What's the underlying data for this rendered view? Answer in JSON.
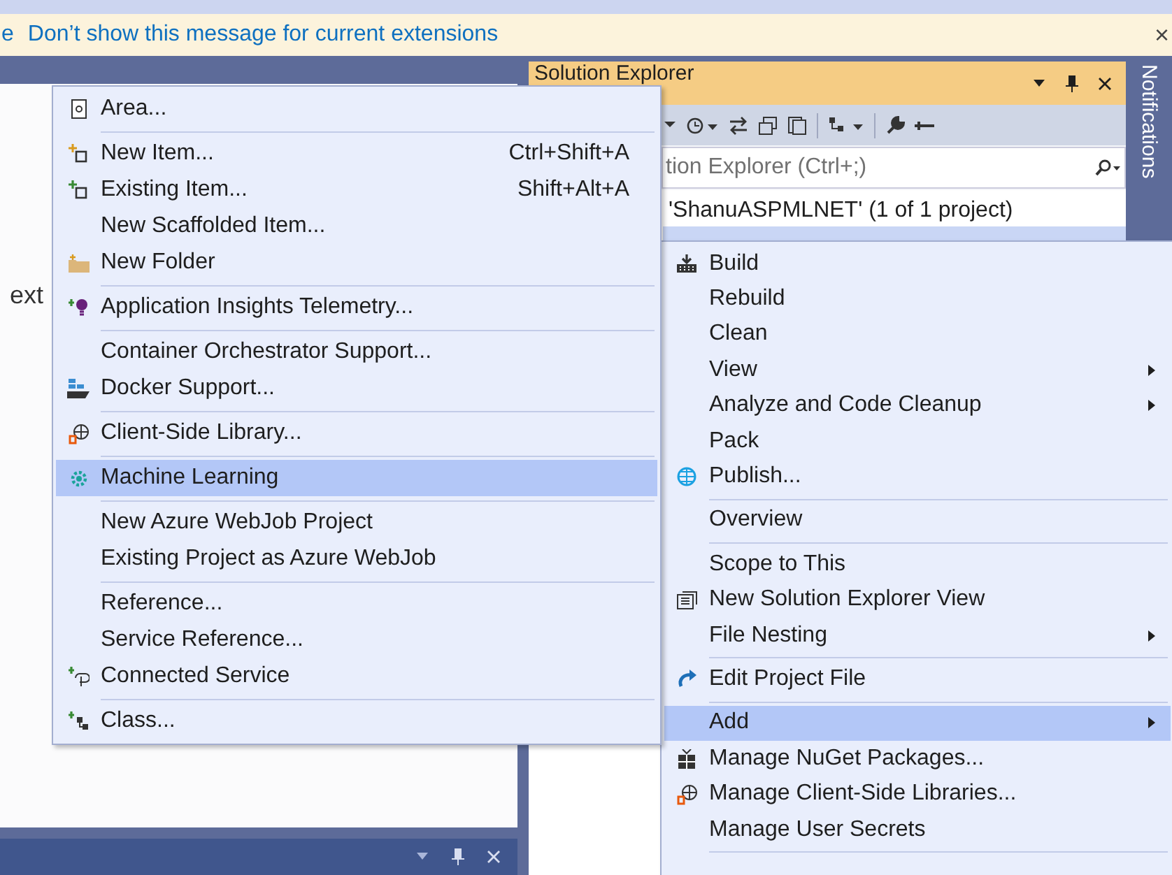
{
  "infobar": {
    "cut_text": "e",
    "link": "Don’t show this message for current extensions",
    "close": "×"
  },
  "editor": {
    "cut_text": "ext"
  },
  "solution_explorer": {
    "title": "Solution Explorer",
    "search": {
      "placeholder": "tion Explorer (Ctrl+;)"
    },
    "tree": [
      {
        "label": "'ShanuASPMLNET' (1 of 1 project)",
        "selected": false
      }
    ]
  },
  "notifications_tab": "Notifications",
  "add_submenu": {
    "groups": [
      [
        {
          "label": "Area...",
          "submenu": false,
          "selected": false
        }
      ],
      [
        {
          "label": "New Item...",
          "shortcut": "Ctrl+Shift+A",
          "submenu": false,
          "selected": false
        },
        {
          "label": "Existing Item...",
          "shortcut": "Shift+Alt+A",
          "submenu": false,
          "selected": false
        },
        {
          "label": "New Scaffolded Item...",
          "submenu": false,
          "selected": false
        },
        {
          "label": "New Folder",
          "submenu": false,
          "selected": false
        }
      ],
      [
        {
          "label": "Application Insights Telemetry...",
          "submenu": false,
          "selected": false
        }
      ],
      [
        {
          "label": "Container Orchestrator Support...",
          "submenu": false,
          "selected": false
        },
        {
          "label": "Docker Support...",
          "submenu": false,
          "selected": false
        }
      ],
      [
        {
          "label": "Client-Side Library...",
          "submenu": false,
          "selected": false
        }
      ],
      [
        {
          "label": "Machine Learning",
          "submenu": false,
          "selected": true
        }
      ],
      [
        {
          "label": "New Azure WebJob Project",
          "submenu": false,
          "selected": false
        },
        {
          "label": "Existing Project as Azure WebJob",
          "submenu": false,
          "selected": false
        }
      ],
      [
        {
          "label": "Reference...",
          "submenu": false,
          "selected": false
        },
        {
          "label": "Service Reference...",
          "submenu": false,
          "selected": false
        },
        {
          "label": "Connected Service",
          "submenu": false,
          "selected": false
        }
      ],
      [
        {
          "label": "Class...",
          "submenu": false,
          "selected": false
        }
      ]
    ]
  },
  "project_menu": {
    "groups": [
      [
        {
          "label": "Build",
          "submenu": false,
          "selected": false
        },
        {
          "label": "Rebuild",
          "submenu": false,
          "selected": false
        },
        {
          "label": "Clean",
          "submenu": false,
          "selected": false
        },
        {
          "label": "View",
          "submenu": true,
          "selected": false
        },
        {
          "label": "Analyze and Code Cleanup",
          "submenu": true,
          "selected": false
        },
        {
          "label": "Pack",
          "submenu": false,
          "selected": false
        },
        {
          "label": "Publish...",
          "submenu": false,
          "selected": false
        }
      ],
      [
        {
          "label": "Overview",
          "submenu": false,
          "selected": false
        }
      ],
      [
        {
          "label": "Scope to This",
          "submenu": false,
          "selected": false
        },
        {
          "label": "New Solution Explorer View",
          "submenu": false,
          "selected": false
        },
        {
          "label": "File Nesting",
          "submenu": true,
          "selected": false
        }
      ],
      [
        {
          "label": "Edit Project File",
          "submenu": false,
          "selected": false
        }
      ],
      [
        {
          "label": "Add",
          "submenu": true,
          "selected": true
        },
        {
          "label": "Manage NuGet Packages...",
          "submenu": false,
          "selected": false
        },
        {
          "label": "Manage Client-Side Libraries...",
          "submenu": false,
          "selected": false
        },
        {
          "label": "Manage User Secrets",
          "submenu": false,
          "selected": false
        }
      ]
    ]
  }
}
